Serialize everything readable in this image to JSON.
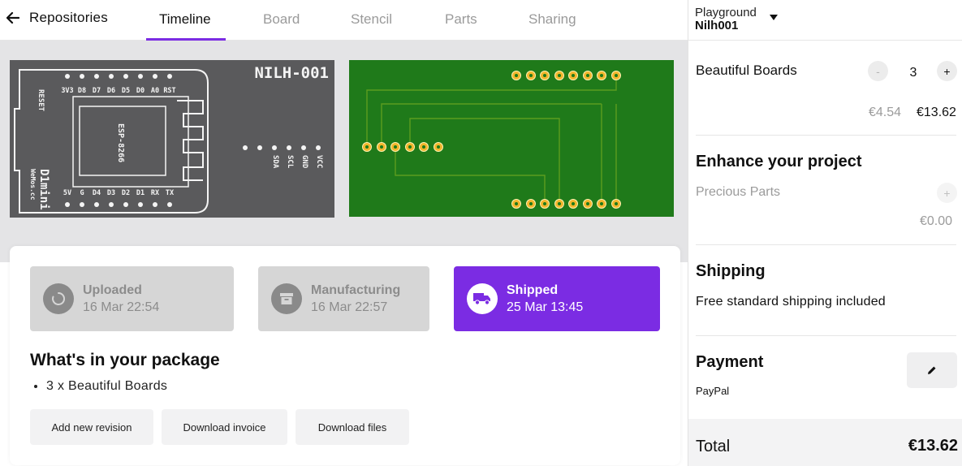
{
  "nav": {
    "back_label": "Repositories",
    "tabs": [
      {
        "label": "Timeline",
        "active": true
      },
      {
        "label": "Board",
        "active": false
      },
      {
        "label": "Stencil",
        "active": false
      },
      {
        "label": "Parts",
        "active": false
      },
      {
        "label": "Sharing",
        "active": false
      }
    ],
    "accent_color": "#7b2ce3"
  },
  "board": {
    "name": "NILH-001",
    "module": "ESP-8266",
    "module_name": "D1mini",
    "module_brand": "WeMos.cc",
    "reset_label": "RESET",
    "top_pins": [
      "3V3",
      "D8",
      "D7",
      "D6",
      "D5",
      "D0",
      "A0",
      "RST"
    ],
    "bottom_pins": [
      "5V",
      "G",
      "D4",
      "D3",
      "D2",
      "D1",
      "RX",
      "TX"
    ],
    "i2c_pins": [
      "SDA",
      "SCL",
      "GND",
      "VCC"
    ],
    "silkscreen_color": "#5a5a5c",
    "pcb_color": "#1f7a1a",
    "pad_color": "#f2b62c"
  },
  "timeline": {
    "steps": [
      {
        "label": "Uploaded",
        "date": "16 Mar 22:54",
        "icon": "spinner-icon",
        "state": "done"
      },
      {
        "label": "Manufacturing",
        "date": "16 Mar 22:57",
        "icon": "archive-box-icon",
        "state": "done"
      },
      {
        "label": "Shipped",
        "date": "25 Mar 13:45",
        "icon": "truck-icon",
        "state": "current"
      }
    ]
  },
  "package": {
    "title": "What's in your package",
    "items": [
      "3 x Beautiful Boards"
    ]
  },
  "actions": {
    "add_revision": "Add new revision",
    "download_invoice": "Download invoice",
    "download_files": "Download files"
  },
  "sidebar": {
    "project_label": "Playground",
    "project_name": "Nilh001",
    "order_item": {
      "name": "Beautiful Boards",
      "minus": "-",
      "plus": "+",
      "quantity": "3",
      "unit_price": "€4.54",
      "line_total": "€13.62"
    },
    "enhance": {
      "title": "Enhance your project",
      "part_name": "Precious Parts",
      "plus": "+",
      "price": "€0.00"
    },
    "shipping": {
      "title": "Shipping",
      "text": "Free standard shipping included"
    },
    "payment": {
      "title": "Payment",
      "method": "PayPal"
    },
    "total": {
      "label": "Total",
      "amount": "€13.62"
    }
  }
}
